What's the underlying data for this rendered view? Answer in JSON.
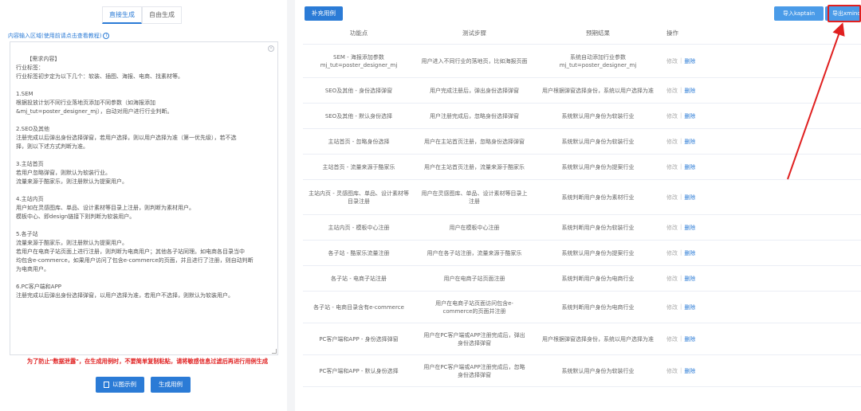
{
  "left": {
    "tabs": [
      "直接生成",
      "自由生成"
    ],
    "hint": "内容输入区域(使用前请点击查看教程)",
    "hint_icon": "info-icon",
    "textarea_text": "【需求内容】\n行业标签：\n行业标签初步定为以下几个：软装、插图、海报、电商、找素材等。\n\n1.SEM\n根据投放计划不同行业落地页添加不同参数（如海报添加\n&mj_tut=poster_designer_mj），自动对用户进行行业判断。\n\n2.SEO及其他\n注册完成以后弹出身份选择弹窗，若用户选择，则以用户选择为准（第一优先级），若不选\n择，则以下述方式判断为准。\n\n3.主站首页\n若用户忽略弹窗，则默认为软装行业。\n流量来源于酷家乐，则注册默认为提案用户。\n\n4.主站内页\n用户如在灵感图库、单品、设计素材等目录上注册，则判断为素材用户。\n模板中心、即design链接下则判断为软装用户。\n\n5.各子站\n流量来源于酷家乐，则注册默认为提案用户。\n若用户在电商子站页面上进行注册，则判断为电商用户；其他各子站同理。如电商各目录当中\n均包含e-commerce，如果用户访问了包含e-commerce的页面，并且进行了注册，则自动判断\n为电商用户。\n\n6.PC客户端和APP\n注册完成以后弹出身份选择弹窗，以用户选择为准，若用户不选择，则默认为软装用户。",
    "warning": "为了防止\"数据泄露\"，在生成用例时，不要简单复制粘贴，请将敏感信息过滤后再进行用例生成",
    "btn_example": "以图示例",
    "btn_generate": "生成用例"
  },
  "right": {
    "btn_supplement": "补充用例",
    "btn_import": "导入kaptain",
    "btn_export": "导出xmind",
    "columns": [
      "功能点",
      "测试步骤",
      "预期结果",
      "操作"
    ],
    "op_edit": "修改",
    "op_sep": "|",
    "op_delete": "删除",
    "rows": [
      {
        "feature": "SEM - 海报添加参数 mj_tut=poster_designer_mj",
        "steps": "用户进入不同行业的落地页，比如海报页面",
        "expected": "系统自动添加行业参数 mj_tut=poster_designer_mj"
      },
      {
        "feature": "SEO及其他 - 身份选择弹窗",
        "steps": "用户完成注册后，弹出身份选择弹窗",
        "expected": "用户根据弹窗选择身份，系统以用户选择为准"
      },
      {
        "feature": "SEO及其他 - 默认身份选择",
        "steps": "用户注册完成后，忽略身份选择弹窗",
        "expected": "系统默认用户身份为软装行业"
      },
      {
        "feature": "主站首页 - 忽略身份选择",
        "steps": "用户在主站首页注册，忽略身份选择弹窗",
        "expected": "系统默认用户身份为软装行业"
      },
      {
        "feature": "主站首页 - 流量来源于酷家乐",
        "steps": "用户在主站首页注册，流量来源于酷家乐",
        "expected": "系统默认用户身份为提案行业"
      },
      {
        "feature": "主站内页 - 灵感图库、单品、设计素材等目录注册",
        "steps": "用户在灵感图库、单品、设计素材等目录上注册",
        "expected": "系统判断用户身份为素材行业"
      },
      {
        "feature": "主站内页 - 模板中心注册",
        "steps": "用户在模板中心注册",
        "expected": "系统判断用户身份为软装行业"
      },
      {
        "feature": "各子站 - 酷家乐流量注册",
        "steps": "用户在各子站注册，流量来源于酷家乐",
        "expected": "系统默认用户身份为提案行业"
      },
      {
        "feature": "各子站 - 电商子站注册",
        "steps": "用户在电商子站页面注册",
        "expected": "系统判断用户身份为电商行业"
      },
      {
        "feature": "各子站 - 电商目录含有e-commerce",
        "steps": "用户在电商子站页面访问包含e-commerce的页面并注册",
        "expected": "系统判断用户身份为电商行业"
      },
      {
        "feature": "PC客户端和APP - 身份选择弹窗",
        "steps": "用户在PC客户端或APP注册完成后，弹出身份选择弹窗",
        "expected": "用户根据弹窗选择身份，系统以用户选择为准"
      },
      {
        "feature": "PC客户端和APP - 默认身份选择",
        "steps": "用户在PC客户端或APP注册完成后，忽略身份选择弹窗",
        "expected": "系统默认用户身份为软装行业"
      }
    ]
  },
  "colors": {
    "primary": "#2b7bd6",
    "warning": "#e02020",
    "annotation": "#e02020"
  }
}
